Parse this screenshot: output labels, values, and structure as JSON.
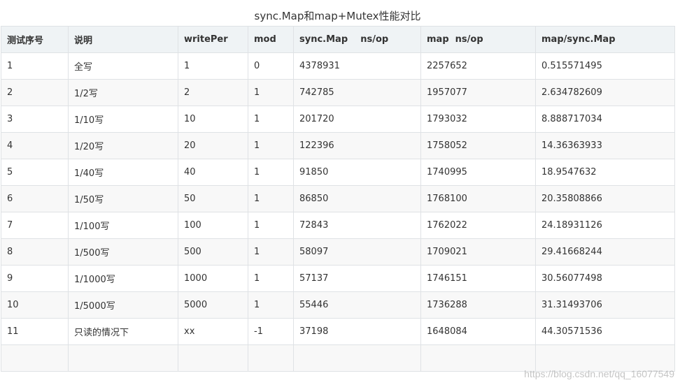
{
  "caption": "sync.Map和map+Mutex性能对比",
  "table": {
    "headers": [
      "测试序号",
      "说明",
      "writePer",
      "mod",
      "sync.Map    ns/op",
      "map  ns/op",
      "map/sync.Map"
    ],
    "rows": [
      [
        "1",
        "全写",
        "1",
        "0",
        "4378931",
        "2257652",
        "0.515571495"
      ],
      [
        "2",
        "1/2写",
        "2",
        "1",
        "742785",
        "1957077",
        "2.634782609"
      ],
      [
        "3",
        "1/10写",
        "10",
        "1",
        "201720",
        "1793032",
        "8.888717034"
      ],
      [
        "4",
        "1/20写",
        "20",
        "1",
        "122396",
        "1758052",
        "14.36363933"
      ],
      [
        "5",
        "1/40写",
        "40",
        "1",
        "91850",
        "1740995",
        "18.9547632"
      ],
      [
        "6",
        "1/50写",
        "50",
        "1",
        "86850",
        "1768100",
        "20.35808866"
      ],
      [
        "7",
        "1/100写",
        "100",
        "1",
        "72843",
        "1762022",
        "24.18931126"
      ],
      [
        "8",
        "1/500写",
        "500",
        "1",
        "58097",
        "1709021",
        "29.41668244"
      ],
      [
        "9",
        "1/1000写",
        "1000",
        "1",
        "57137",
        "1746151",
        "30.56077498"
      ],
      [
        "10",
        "1/5000写",
        "5000",
        "1",
        "55446",
        "1736288",
        "31.31493706"
      ],
      [
        "11",
        "只读的情况下",
        "xx",
        "-1",
        "37198",
        "1648084",
        "44.30571536"
      ],
      [
        "",
        "",
        "",
        "",
        "",
        "",
        ""
      ]
    ]
  },
  "watermark": "https://blog.csdn.net/qq_16077549"
}
